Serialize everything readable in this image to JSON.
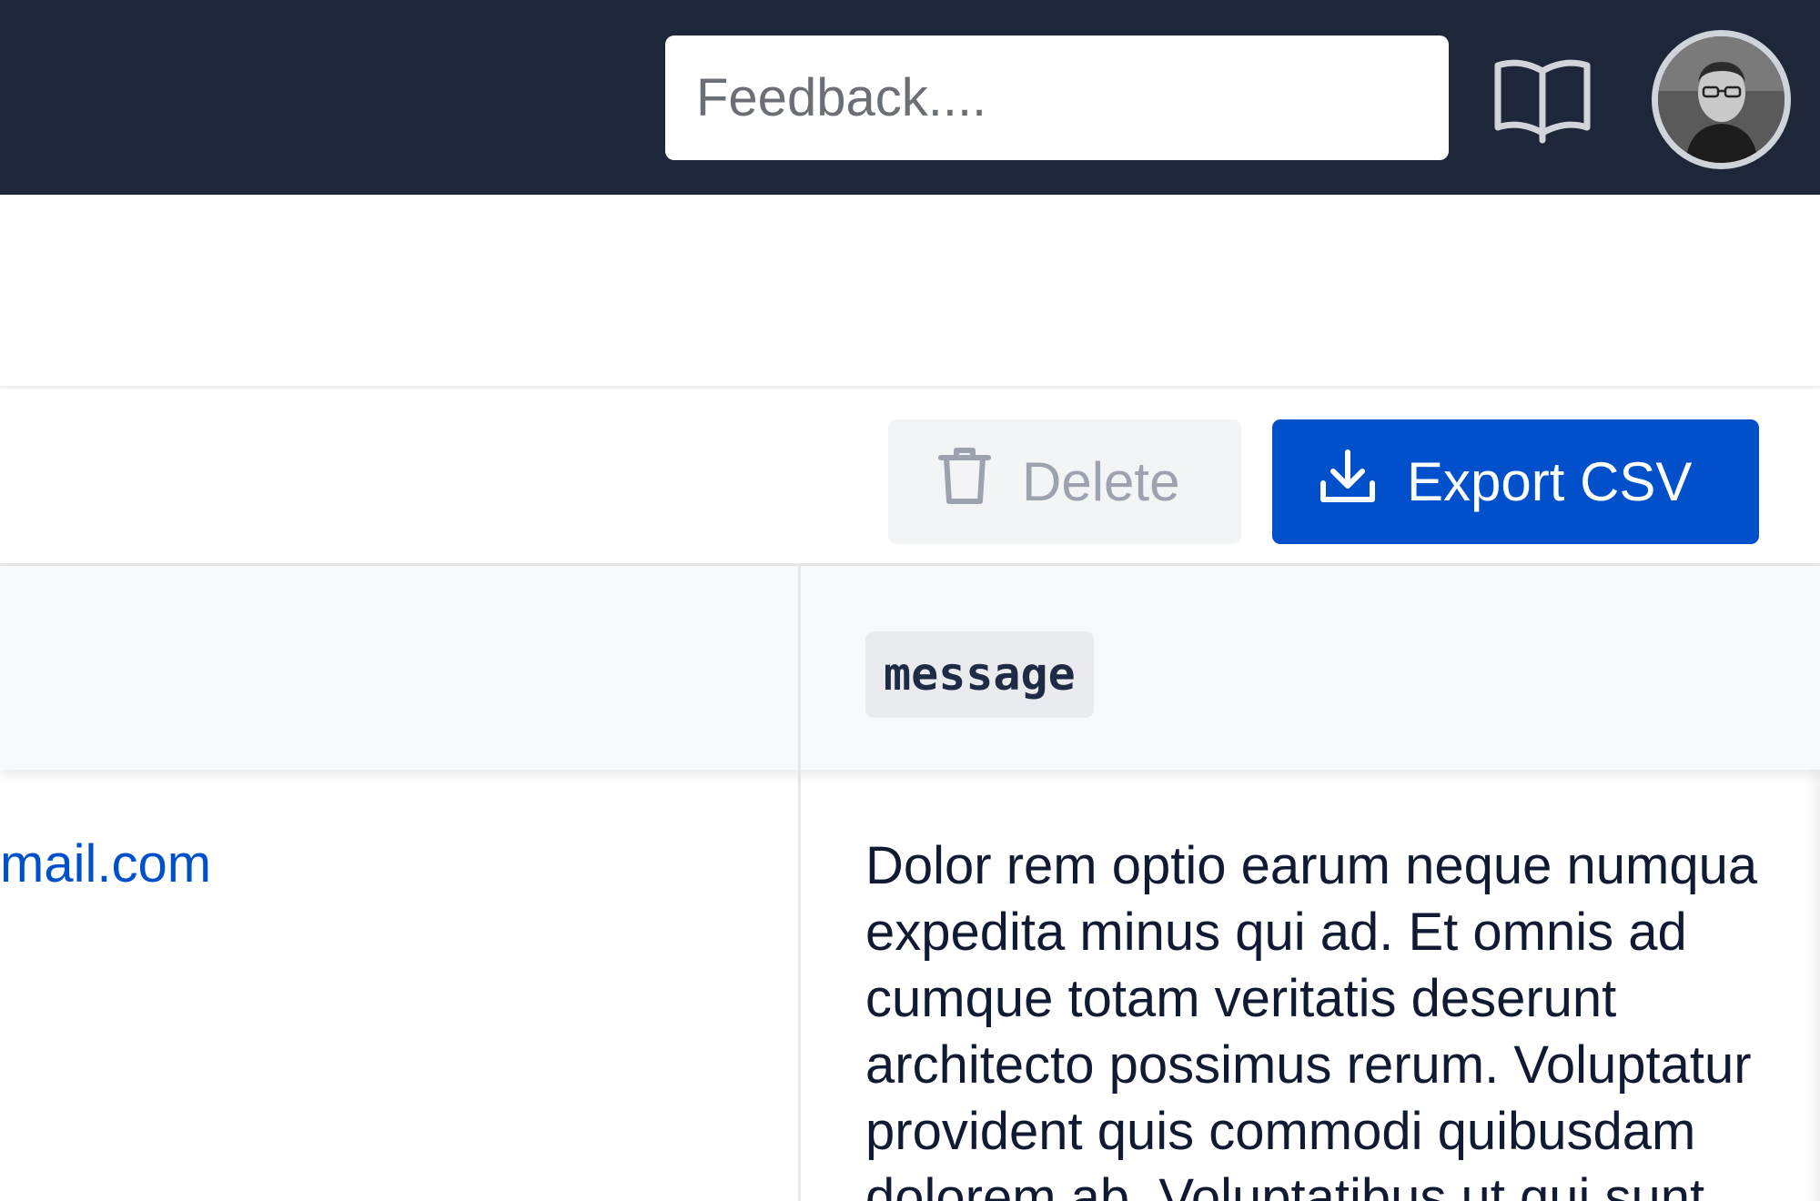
{
  "header": {
    "feedback_placeholder": "Feedback....",
    "docs_icon": "book-open-icon",
    "avatar_alt": "user avatar"
  },
  "toolbar": {
    "delete_label": "Delete",
    "delete_icon": "trash-icon",
    "delete_disabled": true,
    "export_label": "Export CSV",
    "export_icon": "download-icon"
  },
  "table": {
    "columns": [
      "message"
    ],
    "rows": [
      {
        "email": "mail.com",
        "message_lines": [
          "Dolor rem optio earum neque numqua",
          "expedita minus qui ad. Et omnis ad",
          "cumque totam veritatis deserunt",
          "architecto possimus rerum. Voluptatur",
          "provident quis commodi quibusdam",
          "dolorem ab. Voluptatibus ut qui sunt"
        ]
      }
    ]
  },
  "colors": {
    "topbar": "#1d2739",
    "primary": "#0050cc",
    "disabled_bg": "#f3f4f6",
    "disabled_text": "#9ca3af",
    "text": "#111a33"
  }
}
